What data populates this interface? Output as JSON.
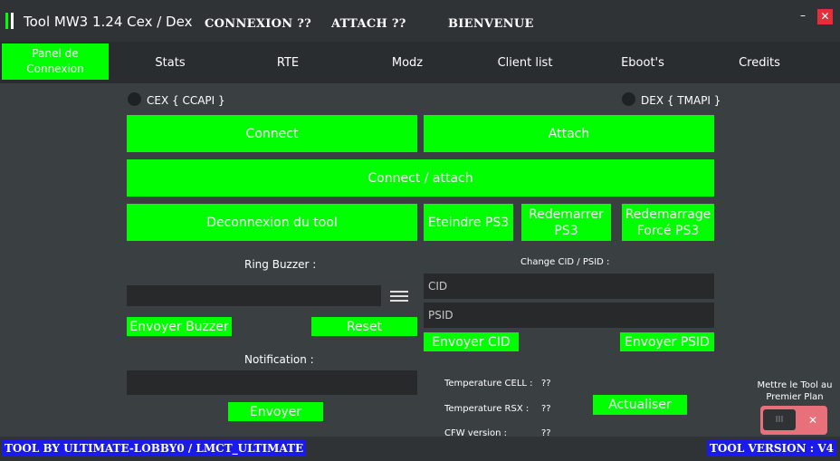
{
  "titlebar": {
    "title": "Tool MW3 1.24 Cex / Dex",
    "connexion_status": "CONNEXION ??",
    "attach_status": "ATTACH ??",
    "welcome": "BIENVENUE",
    "minimize": "–",
    "close": "✕"
  },
  "tabs": [
    {
      "label": "Panel de Connexion",
      "active": true
    },
    {
      "label": "Stats"
    },
    {
      "label": "RTE"
    },
    {
      "label": "Modz"
    },
    {
      "label": "Client list"
    },
    {
      "label": "Eboot's"
    },
    {
      "label": "Credits"
    }
  ],
  "connection": {
    "cex_label": "CEX { CCAPI }",
    "dex_label": "DEX { TMAPI }",
    "connect": "Connect",
    "attach": "Attach",
    "connect_attach": "Connect / attach",
    "disconnect": "Deconnexion du tool",
    "shutdown": "Eteindre PS3",
    "restart": "Redemarrer PS3",
    "force_restart": "Redemarrage Forcé PS3"
  },
  "buzzer": {
    "label": "Ring Buzzer :",
    "send": "Envoyer Buzzer",
    "reset": "Reset"
  },
  "notification": {
    "label": "Notification :",
    "send": "Envoyer"
  },
  "cid_psid": {
    "label": "Change CID / PSID :",
    "cid_placeholder": "CID",
    "psid_placeholder": "PSID",
    "send_cid": "Envoyer CID",
    "send_psid": "Envoyer PSID"
  },
  "info": {
    "temp_cell_label": "Temperature CELL :",
    "temp_cell_value": "??",
    "temp_rsx_label": "Temperature RSX :",
    "temp_rsx_value": "??",
    "cfw_label": "CFW version :",
    "cfw_value": "??",
    "refresh": "Actualiser"
  },
  "topmost": {
    "label": "Mettre le Tool au Premier Plan",
    "knob": "III",
    "off": "✕"
  },
  "footer": {
    "left": "TOOL BY ULTIMATE-LOBBY0 / LMCT_ULTIMATE",
    "right": "TOOL VERSION : V4"
  },
  "colors": {
    "accent": "#00ff00",
    "background": "#3a3f42",
    "header": "#2f3336",
    "footer_badge": "#1a1aee",
    "close": "#e0303a",
    "toggle": "#e8707a"
  }
}
